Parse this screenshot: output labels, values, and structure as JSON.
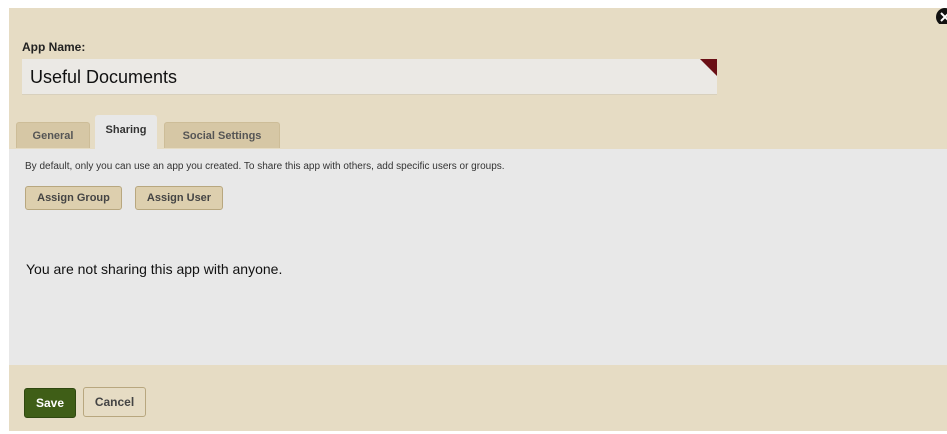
{
  "form": {
    "app_name_label": "App Name:",
    "app_name_value": "Useful Documents"
  },
  "tabs": [
    {
      "label": "General",
      "active": false
    },
    {
      "label": "Sharing",
      "active": true
    },
    {
      "label": "Social Settings",
      "active": false
    }
  ],
  "sharing": {
    "info_text": "By default, only you can use an app you created. To share this app with others, add specific users or groups.",
    "assign_group_label": "Assign Group",
    "assign_user_label": "Assign User",
    "empty_message": "You are not sharing this app with anyone."
  },
  "footer": {
    "save_label": "Save",
    "cancel_label": "Cancel"
  },
  "icons": {
    "close": "close-icon",
    "required_marker": "required-corner-marker"
  },
  "colors": {
    "dialog_bg": "#e6dcc4",
    "content_bg": "#e8e8e8",
    "save_bg": "#3f5e17",
    "required_marker": "#6a0f15"
  }
}
